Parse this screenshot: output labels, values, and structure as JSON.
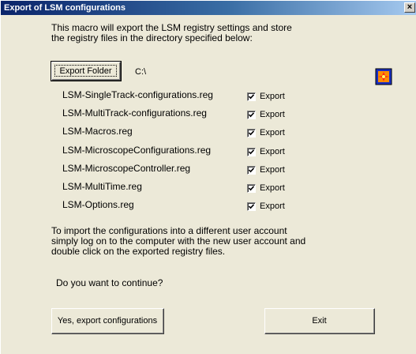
{
  "window": {
    "title": "Export of LSM configurations",
    "close_glyph": "×"
  },
  "intro": {
    "line1": "This macro will export the LSM registry settings and store",
    "line2": "the registry files in the directory specified below:"
  },
  "export_folder": {
    "button_label": "Export Folder",
    "path": "C:\\"
  },
  "files": [
    {
      "name": "LSM-SingleTrack-configurations.reg",
      "checked": true,
      "checkbox_label": "Export"
    },
    {
      "name": "LSM-MultiTrack-configurations.reg",
      "checked": true,
      "checkbox_label": "Export"
    },
    {
      "name": "LSM-Macros.reg",
      "checked": true,
      "checkbox_label": "Export"
    },
    {
      "name": "LSM-MicroscopeConfigurations.reg",
      "checked": true,
      "checkbox_label": "Export"
    },
    {
      "name": "LSM-MicroscopeController.reg",
      "checked": true,
      "checkbox_label": "Export"
    },
    {
      "name": "LSM-MultiTime.reg",
      "checked": true,
      "checkbox_label": "Export"
    },
    {
      "name": "LSM-Options.reg",
      "checked": true,
      "checkbox_label": "Export"
    }
  ],
  "note": {
    "line1": "To import the configurations into a different user account",
    "line2": "simply log on to the computer with the new user account and",
    "line3": "double click on the exported registry files."
  },
  "question": "Do you want to continue?",
  "buttons": {
    "confirm": "Yes, export configurations",
    "exit": "Exit"
  },
  "icons": {
    "app": "lsm-app-icon",
    "close": "close-icon",
    "check": "checkmark-icon"
  },
  "colors": {
    "titlebar_start": "#0a246a",
    "titlebar_end": "#a6caf0",
    "dialog_bg": "#ece9d8"
  }
}
